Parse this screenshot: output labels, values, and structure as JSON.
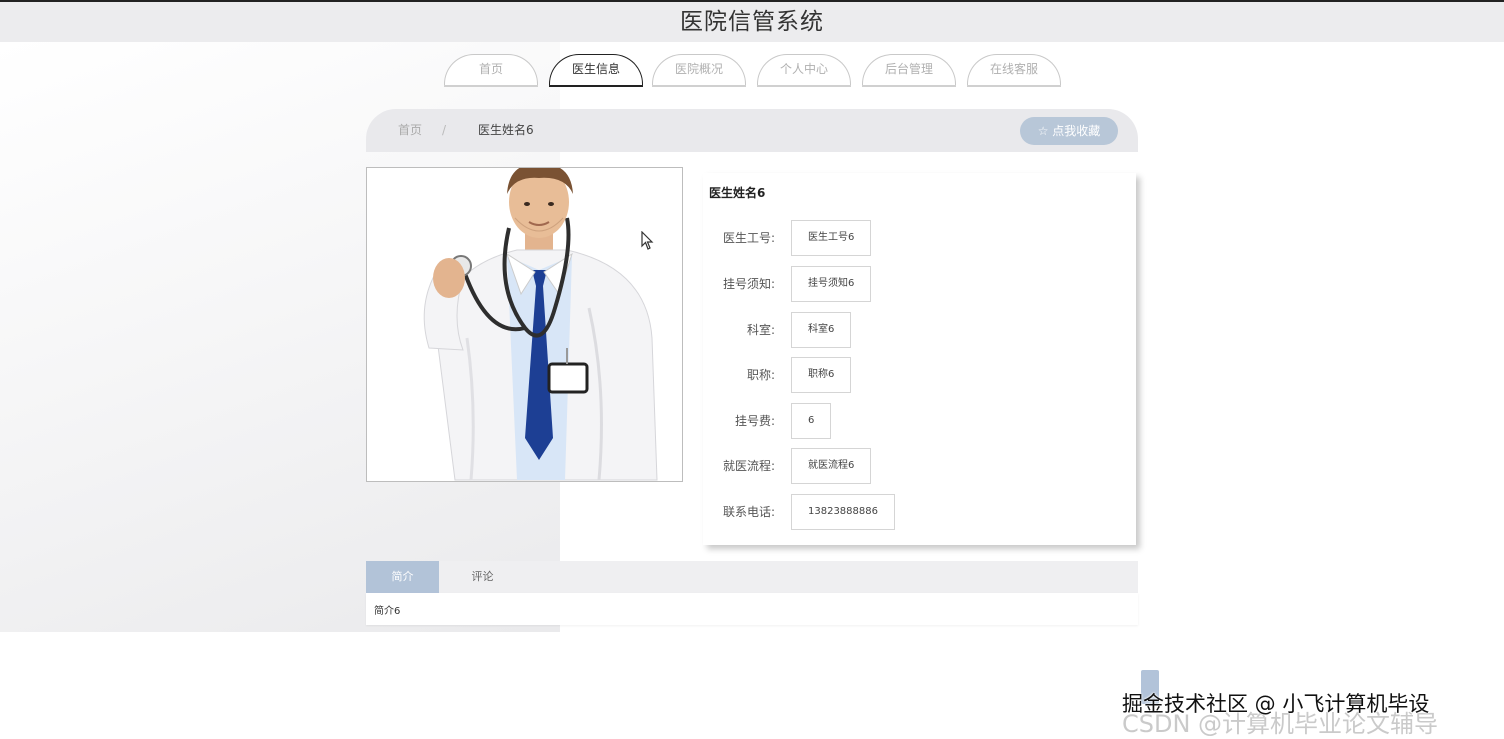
{
  "header": {
    "title": "医院信管系统"
  },
  "nav": {
    "items": [
      {
        "label": "首页"
      },
      {
        "label": "医生信息"
      },
      {
        "label": "医院概况"
      },
      {
        "label": "个人中心"
      },
      {
        "label": "后台管理"
      },
      {
        "label": "在线客服"
      }
    ],
    "active_index": 1
  },
  "breadcrumb": {
    "home": "首页",
    "separator": "/",
    "current": "医生姓名6"
  },
  "favorite_button": {
    "label": "☆ 点我收藏"
  },
  "doctor": {
    "name": "医生姓名6",
    "photo_icon": "doctor-portrait",
    "fields": [
      {
        "label": "医生工号:",
        "value": "医生工号6"
      },
      {
        "label": "挂号须知:",
        "value": "挂号须知6"
      },
      {
        "label": "科室:",
        "value": "科室6"
      },
      {
        "label": "职称:",
        "value": "职称6"
      },
      {
        "label": "挂号费:",
        "value": "6"
      },
      {
        "label": "就医流程:",
        "value": "就医流程6"
      },
      {
        "label": "联系电话:",
        "value": "13823888886"
      }
    ]
  },
  "tabs": {
    "intro_label": "简介",
    "comments_label": "评论",
    "intro_content": "简介6"
  },
  "watermark": {
    "primary": "掘金技术社区 @ 小飞计算机毕设",
    "secondary": "CSDN @计算机毕业论文辅导"
  },
  "colors": {
    "header_bg": "#ececee",
    "accent_blue": "#b8c7d8",
    "active_tab": "#b2c3d8"
  }
}
